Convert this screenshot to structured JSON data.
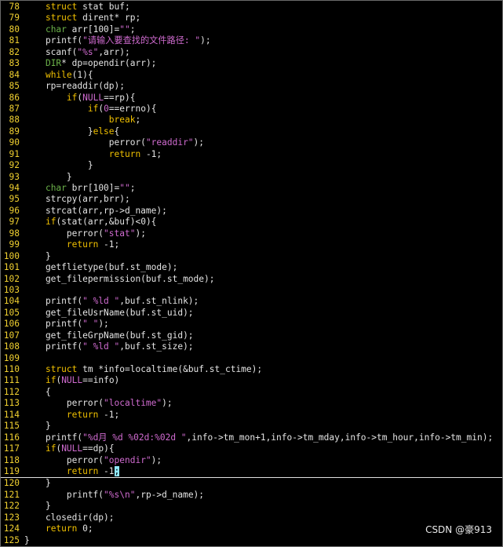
{
  "colors": {
    "keyword": "#f0c000",
    "type": "#6cb24a",
    "string": "#d06bd0",
    "text": "#e4e4e4",
    "line_number": "#f0d030",
    "cursor": "#8fe8ff"
  },
  "cursor_line": 119,
  "lines": [
    {
      "n": "78",
      "tokens": [
        [
          "    ",
          "txt"
        ],
        [
          "struct",
          "kw"
        ],
        [
          " stat buf;",
          "txt"
        ]
      ]
    },
    {
      "n": "79",
      "tokens": [
        [
          "    ",
          "txt"
        ],
        [
          "struct",
          "kw"
        ],
        [
          " dirent* rp;",
          "txt"
        ]
      ]
    },
    {
      "n": "80",
      "tokens": [
        [
          "    ",
          "txt"
        ],
        [
          "char",
          "tp"
        ],
        [
          " arr[100]=",
          "txt"
        ],
        [
          "\"\"",
          "str"
        ],
        [
          ";",
          "txt"
        ]
      ]
    },
    {
      "n": "81",
      "tokens": [
        [
          "    printf(",
          "txt"
        ],
        [
          "\"请输入要查找的文件路径: \"",
          "str"
        ],
        [
          ");",
          "txt"
        ]
      ]
    },
    {
      "n": "82",
      "tokens": [
        [
          "    scanf(",
          "txt"
        ],
        [
          "\"%s\"",
          "str"
        ],
        [
          ",arr);",
          "txt"
        ]
      ]
    },
    {
      "n": "83",
      "tokens": [
        [
          "    ",
          "txt"
        ],
        [
          "DIR",
          "tp"
        ],
        [
          "* dp=opendir(arr);",
          "txt"
        ]
      ]
    },
    {
      "n": "84",
      "tokens": [
        [
          "    ",
          "txt"
        ],
        [
          "while",
          "kw"
        ],
        [
          "(1){",
          "txt"
        ]
      ]
    },
    {
      "n": "85",
      "tokens": [
        [
          "    rp=readdir(dp);",
          "txt"
        ]
      ]
    },
    {
      "n": "86",
      "tokens": [
        [
          "        ",
          "txt"
        ],
        [
          "if",
          "kw"
        ],
        [
          "(",
          "txt"
        ],
        [
          "NULL",
          "str"
        ],
        [
          "==rp){",
          "txt"
        ]
      ]
    },
    {
      "n": "87",
      "tokens": [
        [
          "            ",
          "txt"
        ],
        [
          "if",
          "kw"
        ],
        [
          "(",
          "txt"
        ],
        [
          "0",
          "str"
        ],
        [
          "==errno){",
          "txt"
        ]
      ]
    },
    {
      "n": "88",
      "tokens": [
        [
          "                ",
          "txt"
        ],
        [
          "break",
          "kw"
        ],
        [
          ";",
          "txt"
        ]
      ]
    },
    {
      "n": "89",
      "tokens": [
        [
          "            }",
          "txt"
        ],
        [
          "else",
          "kw"
        ],
        [
          "{",
          "txt"
        ]
      ]
    },
    {
      "n": "90",
      "tokens": [
        [
          "                perror(",
          "txt"
        ],
        [
          "\"readdir\"",
          "str"
        ],
        [
          ");",
          "txt"
        ]
      ]
    },
    {
      "n": "91",
      "tokens": [
        [
          "                ",
          "txt"
        ],
        [
          "return",
          "kw"
        ],
        [
          " -1;",
          "txt"
        ]
      ]
    },
    {
      "n": "92",
      "tokens": [
        [
          "            }",
          "txt"
        ]
      ]
    },
    {
      "n": "93",
      "tokens": [
        [
          "        }",
          "txt"
        ]
      ]
    },
    {
      "n": "94",
      "tokens": [
        [
          "    ",
          "txt"
        ],
        [
          "char",
          "tp"
        ],
        [
          " brr[100]=",
          "txt"
        ],
        [
          "\"\"",
          "str"
        ],
        [
          ";",
          "txt"
        ]
      ]
    },
    {
      "n": "95",
      "tokens": [
        [
          "    strcpy(arr,brr);",
          "txt"
        ]
      ]
    },
    {
      "n": "96",
      "tokens": [
        [
          "    strcat(arr,rp->d_name);",
          "txt"
        ]
      ]
    },
    {
      "n": "97",
      "tokens": [
        [
          "    ",
          "txt"
        ],
        [
          "if",
          "kw"
        ],
        [
          "(stat(arr,&buf)<0){",
          "txt"
        ]
      ]
    },
    {
      "n": "98",
      "tokens": [
        [
          "        perror(",
          "txt"
        ],
        [
          "\"stat\"",
          "str"
        ],
        [
          ");",
          "txt"
        ]
      ]
    },
    {
      "n": "99",
      "tokens": [
        [
          "        ",
          "txt"
        ],
        [
          "return",
          "kw"
        ],
        [
          " -1;",
          "txt"
        ]
      ]
    },
    {
      "n": "100",
      "tokens": [
        [
          "    }",
          "txt"
        ]
      ]
    },
    {
      "n": "101",
      "tokens": [
        [
          "    getflietype(buf.st_mode);",
          "txt"
        ]
      ]
    },
    {
      "n": "102",
      "tokens": [
        [
          "    get_filepermission(buf.st_mode);",
          "txt"
        ]
      ]
    },
    {
      "n": "103",
      "tokens": []
    },
    {
      "n": "104",
      "tokens": [
        [
          "    printf(",
          "txt"
        ],
        [
          "\" %ld \"",
          "str"
        ],
        [
          ",buf.st_nlink);",
          "txt"
        ]
      ]
    },
    {
      "n": "105",
      "tokens": [
        [
          "    get_fileUsrName(buf.st_uid);",
          "txt"
        ]
      ]
    },
    {
      "n": "106",
      "tokens": [
        [
          "    printf(",
          "txt"
        ],
        [
          "\" \"",
          "str"
        ],
        [
          ");",
          "txt"
        ]
      ]
    },
    {
      "n": "107",
      "tokens": [
        [
          "    get_fileGrpName(buf.st_gid);",
          "txt"
        ]
      ]
    },
    {
      "n": "108",
      "tokens": [
        [
          "    printf(",
          "txt"
        ],
        [
          "\" %ld \"",
          "str"
        ],
        [
          ",buf.st_size);",
          "txt"
        ]
      ]
    },
    {
      "n": "109",
      "tokens": []
    },
    {
      "n": "110",
      "tokens": [
        [
          "    ",
          "txt"
        ],
        [
          "struct",
          "kw"
        ],
        [
          " tm *info=localtime(&buf.st_ctime);",
          "txt"
        ]
      ]
    },
    {
      "n": "111",
      "tokens": [
        [
          "    ",
          "txt"
        ],
        [
          "if",
          "kw"
        ],
        [
          "(",
          "txt"
        ],
        [
          "NULL",
          "str"
        ],
        [
          "==info)",
          "txt"
        ]
      ]
    },
    {
      "n": "112",
      "tokens": [
        [
          "    {",
          "txt"
        ]
      ]
    },
    {
      "n": "113",
      "tokens": [
        [
          "        perror(",
          "txt"
        ],
        [
          "\"localtime\"",
          "str"
        ],
        [
          ");",
          "txt"
        ]
      ]
    },
    {
      "n": "114",
      "tokens": [
        [
          "        ",
          "txt"
        ],
        [
          "return",
          "kw"
        ],
        [
          " -1;",
          "txt"
        ]
      ]
    },
    {
      "n": "115",
      "tokens": [
        [
          "    }",
          "txt"
        ]
      ]
    },
    {
      "n": "116",
      "tokens": [
        [
          "    printf(",
          "txt"
        ],
        [
          "\"%d月 %d %02d:%02d \"",
          "str"
        ],
        [
          ",info->tm_mon+1,info->tm_mday,info->tm_hour,info->tm_min);",
          "txt"
        ]
      ]
    },
    {
      "n": "117",
      "tokens": [
        [
          "    ",
          "txt"
        ],
        [
          "if",
          "kw"
        ],
        [
          "(",
          "txt"
        ],
        [
          "NULL",
          "str"
        ],
        [
          "==dp){",
          "txt"
        ]
      ]
    },
    {
      "n": "118",
      "tokens": [
        [
          "        perror(",
          "txt"
        ],
        [
          "\"opendir\"",
          "str"
        ],
        [
          ");",
          "txt"
        ]
      ]
    },
    {
      "n": "119",
      "tokens": [
        [
          "        ",
          "txt"
        ],
        [
          "return",
          "kw"
        ],
        [
          " -1",
          "txt"
        ],
        [
          ";",
          "cursor"
        ]
      ]
    },
    {
      "n": "120",
      "tokens": [
        [
          "    }",
          "txt"
        ]
      ]
    },
    {
      "n": "121",
      "tokens": [
        [
          "        printf(",
          "txt"
        ],
        [
          "\"%s\\n\"",
          "str"
        ],
        [
          ",rp->d_name);",
          "txt"
        ]
      ]
    },
    {
      "n": "122",
      "tokens": [
        [
          "    }",
          "txt"
        ]
      ]
    },
    {
      "n": "123",
      "tokens": [
        [
          "    closedir(dp);",
          "txt"
        ]
      ]
    },
    {
      "n": "124",
      "tokens": [
        [
          "    ",
          "txt"
        ],
        [
          "return",
          "kw"
        ],
        [
          " 0;",
          "txt"
        ]
      ]
    },
    {
      "n": "125",
      "tokens": [
        [
          "}",
          "txt"
        ]
      ]
    }
  ],
  "watermark": "CSDN @豪913"
}
